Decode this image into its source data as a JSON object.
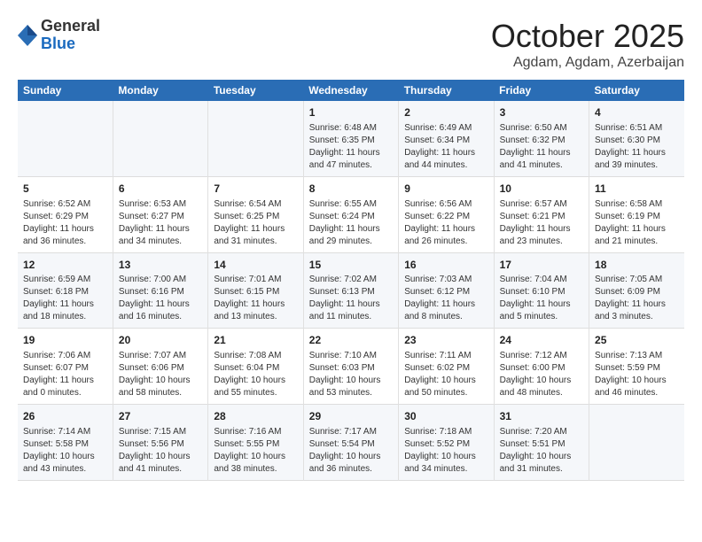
{
  "header": {
    "logo": {
      "general": "General",
      "blue": "Blue"
    },
    "month": "October 2025",
    "location": "Agdam, Agdam, Azerbaijan"
  },
  "weekdays": [
    "Sunday",
    "Monday",
    "Tuesday",
    "Wednesday",
    "Thursday",
    "Friday",
    "Saturday"
  ],
  "weeks": [
    [
      {
        "day": "",
        "info": ""
      },
      {
        "day": "",
        "info": ""
      },
      {
        "day": "",
        "info": ""
      },
      {
        "day": "1",
        "info": "Sunrise: 6:48 AM\nSunset: 6:35 PM\nDaylight: 11 hours\nand 47 minutes."
      },
      {
        "day": "2",
        "info": "Sunrise: 6:49 AM\nSunset: 6:34 PM\nDaylight: 11 hours\nand 44 minutes."
      },
      {
        "day": "3",
        "info": "Sunrise: 6:50 AM\nSunset: 6:32 PM\nDaylight: 11 hours\nand 41 minutes."
      },
      {
        "day": "4",
        "info": "Sunrise: 6:51 AM\nSunset: 6:30 PM\nDaylight: 11 hours\nand 39 minutes."
      }
    ],
    [
      {
        "day": "5",
        "info": "Sunrise: 6:52 AM\nSunset: 6:29 PM\nDaylight: 11 hours\nand 36 minutes."
      },
      {
        "day": "6",
        "info": "Sunrise: 6:53 AM\nSunset: 6:27 PM\nDaylight: 11 hours\nand 34 minutes."
      },
      {
        "day": "7",
        "info": "Sunrise: 6:54 AM\nSunset: 6:25 PM\nDaylight: 11 hours\nand 31 minutes."
      },
      {
        "day": "8",
        "info": "Sunrise: 6:55 AM\nSunset: 6:24 PM\nDaylight: 11 hours\nand 29 minutes."
      },
      {
        "day": "9",
        "info": "Sunrise: 6:56 AM\nSunset: 6:22 PM\nDaylight: 11 hours\nand 26 minutes."
      },
      {
        "day": "10",
        "info": "Sunrise: 6:57 AM\nSunset: 6:21 PM\nDaylight: 11 hours\nand 23 minutes."
      },
      {
        "day": "11",
        "info": "Sunrise: 6:58 AM\nSunset: 6:19 PM\nDaylight: 11 hours\nand 21 minutes."
      }
    ],
    [
      {
        "day": "12",
        "info": "Sunrise: 6:59 AM\nSunset: 6:18 PM\nDaylight: 11 hours\nand 18 minutes."
      },
      {
        "day": "13",
        "info": "Sunrise: 7:00 AM\nSunset: 6:16 PM\nDaylight: 11 hours\nand 16 minutes."
      },
      {
        "day": "14",
        "info": "Sunrise: 7:01 AM\nSunset: 6:15 PM\nDaylight: 11 hours\nand 13 minutes."
      },
      {
        "day": "15",
        "info": "Sunrise: 7:02 AM\nSunset: 6:13 PM\nDaylight: 11 hours\nand 11 minutes."
      },
      {
        "day": "16",
        "info": "Sunrise: 7:03 AM\nSunset: 6:12 PM\nDaylight: 11 hours\nand 8 minutes."
      },
      {
        "day": "17",
        "info": "Sunrise: 7:04 AM\nSunset: 6:10 PM\nDaylight: 11 hours\nand 5 minutes."
      },
      {
        "day": "18",
        "info": "Sunrise: 7:05 AM\nSunset: 6:09 PM\nDaylight: 11 hours\nand 3 minutes."
      }
    ],
    [
      {
        "day": "19",
        "info": "Sunrise: 7:06 AM\nSunset: 6:07 PM\nDaylight: 11 hours\nand 0 minutes."
      },
      {
        "day": "20",
        "info": "Sunrise: 7:07 AM\nSunset: 6:06 PM\nDaylight: 10 hours\nand 58 minutes."
      },
      {
        "day": "21",
        "info": "Sunrise: 7:08 AM\nSunset: 6:04 PM\nDaylight: 10 hours\nand 55 minutes."
      },
      {
        "day": "22",
        "info": "Sunrise: 7:10 AM\nSunset: 6:03 PM\nDaylight: 10 hours\nand 53 minutes."
      },
      {
        "day": "23",
        "info": "Sunrise: 7:11 AM\nSunset: 6:02 PM\nDaylight: 10 hours\nand 50 minutes."
      },
      {
        "day": "24",
        "info": "Sunrise: 7:12 AM\nSunset: 6:00 PM\nDaylight: 10 hours\nand 48 minutes."
      },
      {
        "day": "25",
        "info": "Sunrise: 7:13 AM\nSunset: 5:59 PM\nDaylight: 10 hours\nand 46 minutes."
      }
    ],
    [
      {
        "day": "26",
        "info": "Sunrise: 7:14 AM\nSunset: 5:58 PM\nDaylight: 10 hours\nand 43 minutes."
      },
      {
        "day": "27",
        "info": "Sunrise: 7:15 AM\nSunset: 5:56 PM\nDaylight: 10 hours\nand 41 minutes."
      },
      {
        "day": "28",
        "info": "Sunrise: 7:16 AM\nSunset: 5:55 PM\nDaylight: 10 hours\nand 38 minutes."
      },
      {
        "day": "29",
        "info": "Sunrise: 7:17 AM\nSunset: 5:54 PM\nDaylight: 10 hours\nand 36 minutes."
      },
      {
        "day": "30",
        "info": "Sunrise: 7:18 AM\nSunset: 5:52 PM\nDaylight: 10 hours\nand 34 minutes."
      },
      {
        "day": "31",
        "info": "Sunrise: 7:20 AM\nSunset: 5:51 PM\nDaylight: 10 hours\nand 31 minutes."
      },
      {
        "day": "",
        "info": ""
      }
    ]
  ]
}
